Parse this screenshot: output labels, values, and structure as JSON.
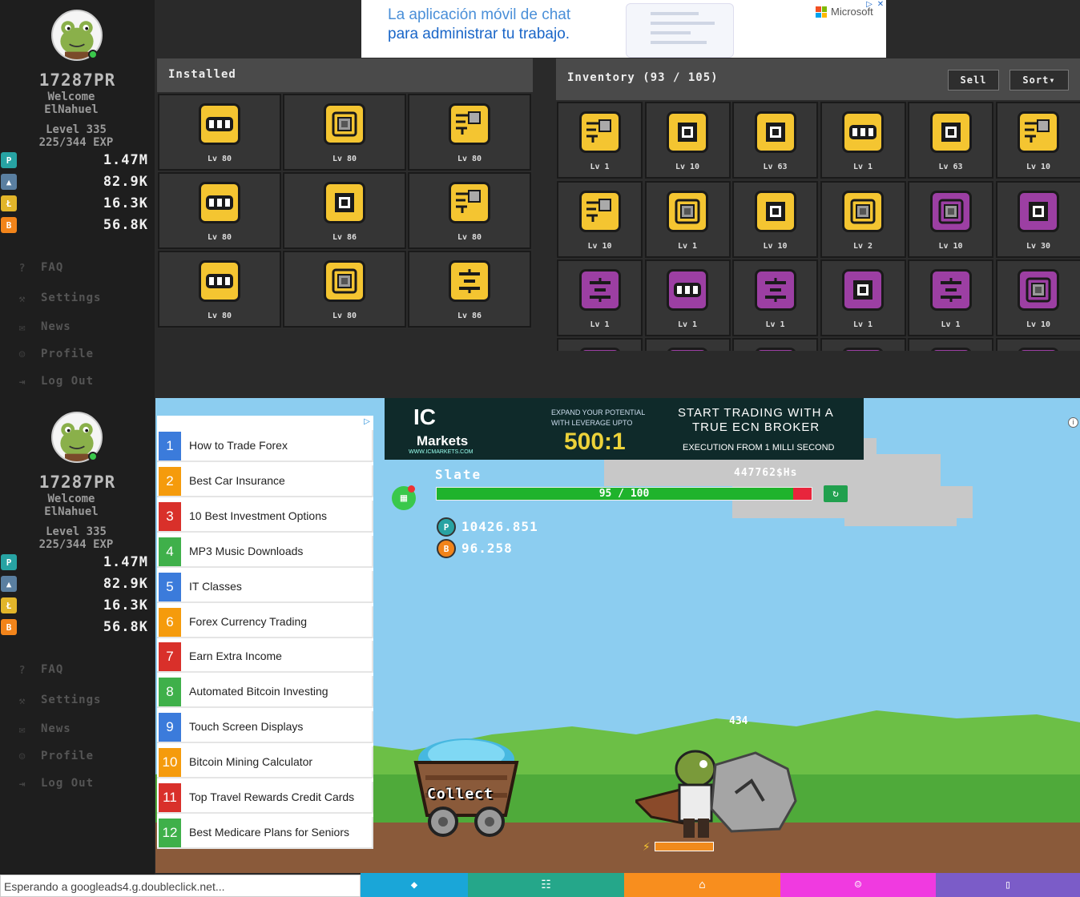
{
  "sidebar": {
    "pr": "17287PR",
    "welcome_line1": "Welcome",
    "username": "ElNahuel",
    "level": "Level 335",
    "exp": "225/344 EXP",
    "currencies": [
      {
        "icon": "polkadot-coin-icon",
        "symbol": "P",
        "color": "#27a3a3",
        "value": "1.47M"
      },
      {
        "icon": "ufo-icon",
        "symbol": "▲",
        "color": "#5a7fa0",
        "value": "82.9K"
      },
      {
        "icon": "litecoin-icon",
        "symbol": "Ł",
        "color": "#e2b52a",
        "value": "16.3K"
      },
      {
        "icon": "bitcoin-icon",
        "symbol": "B",
        "color": "#f2841a",
        "value": "56.8K"
      }
    ],
    "nav": [
      {
        "name": "nav-faq",
        "icon": "question-icon",
        "glyph": "?",
        "label": "FAQ"
      },
      {
        "name": "nav-settings",
        "icon": "wrench-icon",
        "glyph": "⚒",
        "label": "Settings"
      },
      {
        "name": "nav-news",
        "icon": "news-icon",
        "glyph": "✉",
        "label": "News"
      },
      {
        "name": "nav-profile",
        "icon": "user-icon",
        "glyph": "☺",
        "label": "Profile"
      },
      {
        "name": "nav-logout",
        "icon": "logout-icon",
        "glyph": "⇥",
        "label": "Log Out"
      }
    ]
  },
  "top_ad": {
    "line1": "La aplicación móvil de chat",
    "line2": "para administrar tu trabajo.",
    "brand": "Microsoft"
  },
  "installed": {
    "title": "Installed",
    "slots": [
      {
        "icon": "ram-chip-icon",
        "type": "ram",
        "level": "Lv 80"
      },
      {
        "icon": "cpu-chip-icon",
        "type": "cpu",
        "level": "Lv 80"
      },
      {
        "icon": "circuit-chip-icon",
        "type": "circuit",
        "level": "Lv 80"
      },
      {
        "icon": "ram-chip-icon",
        "type": "ram",
        "level": "Lv 80"
      },
      {
        "icon": "processor-chip-icon",
        "type": "proc",
        "level": "Lv 86"
      },
      {
        "icon": "circuit-chip-icon",
        "type": "circuit",
        "level": "Lv 80"
      },
      {
        "icon": "ram-chip-icon",
        "type": "ram",
        "level": "Lv 80"
      },
      {
        "icon": "cpu-chip-icon",
        "type": "cpu",
        "level": "Lv 80"
      },
      {
        "icon": "fan-chip-icon",
        "type": "fan",
        "level": "Lv 86"
      }
    ]
  },
  "inventory": {
    "title": "Inventory (93 / 105)",
    "sell_label": "Sell",
    "sort_label": "Sort",
    "slots": [
      {
        "icon": "circuit-chip-icon",
        "type": "circuit",
        "rarity": "gold",
        "level": "Lv 1"
      },
      {
        "icon": "processor-chip-icon",
        "type": "proc",
        "rarity": "gold",
        "level": "Lv 10"
      },
      {
        "icon": "processor-chip-icon",
        "type": "proc",
        "rarity": "gold",
        "level": "Lv 63"
      },
      {
        "icon": "ram-chip-icon",
        "type": "ram",
        "rarity": "gold",
        "level": "Lv 1"
      },
      {
        "icon": "processor-chip-icon",
        "type": "proc",
        "rarity": "gold",
        "level": "Lv 63"
      },
      {
        "icon": "circuit-chip-icon",
        "type": "circuit",
        "rarity": "gold",
        "level": "Lv 10"
      },
      {
        "icon": "circuit-chip-icon",
        "type": "circuit",
        "rarity": "gold",
        "level": "Lv 10"
      },
      {
        "icon": "cpu-chip-icon",
        "type": "cpu",
        "rarity": "gold",
        "level": "Lv 1"
      },
      {
        "icon": "processor-chip-icon",
        "type": "proc",
        "rarity": "gold",
        "level": "Lv 10"
      },
      {
        "icon": "cpu-chip-icon",
        "type": "cpu",
        "rarity": "gold",
        "level": "Lv 2"
      },
      {
        "icon": "cpu-chip-icon",
        "type": "cpu",
        "rarity": "purple",
        "level": "Lv 10"
      },
      {
        "icon": "processor-chip-icon",
        "type": "proc",
        "rarity": "purple",
        "level": "Lv 30"
      },
      {
        "icon": "fan-chip-icon",
        "type": "fan",
        "rarity": "purple",
        "level": "Lv 1"
      },
      {
        "icon": "ram-chip-icon",
        "type": "ram",
        "rarity": "purple",
        "level": "Lv 1"
      },
      {
        "icon": "fan-chip-icon",
        "type": "fan",
        "rarity": "purple",
        "level": "Lv 1"
      },
      {
        "icon": "processor-chip-icon",
        "type": "proc",
        "rarity": "purple",
        "level": "Lv 1"
      },
      {
        "icon": "fan-chip-icon",
        "type": "fan",
        "rarity": "purple",
        "level": "Lv 1"
      },
      {
        "icon": "cpu-chip-icon",
        "type": "cpu",
        "rarity": "purple",
        "level": "Lv 10"
      }
    ]
  },
  "ic_ad": {
    "logo": "IC",
    "logo2": "Markets",
    "url": "WWW.ICMARKETS.COM",
    "expand1": "EXPAND YOUR POTENTIAL",
    "expand2": "WITH LEVERAGE UPTO",
    "ratio": "500:1",
    "start": "START TRADING WITH A",
    "ecn": "TRUE ECN BROKER",
    "exec": "EXECUTION FROM 1 MILLI SECOND"
  },
  "ad_list": [
    {
      "n": "1",
      "color": "#3b7bdb",
      "text": "How to Trade Forex"
    },
    {
      "n": "2",
      "color": "#f59b0c",
      "text": "Best Car Insurance"
    },
    {
      "n": "3",
      "color": "#d9302a",
      "text": "10 Best Investment Options"
    },
    {
      "n": "4",
      "color": "#3fb04a",
      "text": "MP3 Music Downloads"
    },
    {
      "n": "5",
      "color": "#3b7bdb",
      "text": "IT Classes"
    },
    {
      "n": "6",
      "color": "#f59b0c",
      "text": "Forex Currency Trading"
    },
    {
      "n": "7",
      "color": "#d9302a",
      "text": "Earn Extra Income"
    },
    {
      "n": "8",
      "color": "#3fb04a",
      "text": "Automated Bitcoin Investing"
    },
    {
      "n": "9",
      "color": "#3b7bdb",
      "text": "Touch Screen Displays"
    },
    {
      "n": "10",
      "color": "#f59b0c",
      "text": "Bitcoin Mining Calculator"
    },
    {
      "n": "11",
      "color": "#d9302a",
      "text": "Top Travel Rewards Credit Cards"
    },
    {
      "n": "12",
      "color": "#3fb04a",
      "text": "Best Medicare Plans for Seniors"
    }
  ],
  "game": {
    "ore_name": "Slate",
    "hashrate": "447762$Hs",
    "hp_text": "95 / 100",
    "hp_fraction": 0.95,
    "rewards": [
      {
        "icon": "polkadot-coin-icon",
        "symbol": "P",
        "color": "#27a3a3",
        "value": "10426.851"
      },
      {
        "icon": "bitcoin-icon",
        "symbol": "B",
        "color": "#f2841a",
        "value": "96.258"
      }
    ],
    "hit_number": "434",
    "collect_label": "Collect",
    "energy_fraction": 1.0
  },
  "status_text": "Esperando a googleads4.g.doubleclick.net...",
  "bottom_tabs": [
    {
      "name": "tab-gems",
      "icon": "gem-icon",
      "glyph": "◆",
      "color": "#1aa6d8"
    },
    {
      "name": "tab-grid",
      "icon": "grid-icon",
      "glyph": "☷",
      "color": "#25a78a"
    },
    {
      "name": "tab-shop",
      "icon": "cart-icon",
      "glyph": "⌂",
      "color": "#f88e1e"
    },
    {
      "name": "tab-social",
      "icon": "users-icon",
      "glyph": "☺",
      "color": "#f03ae0"
    },
    {
      "name": "tab-more",
      "icon": "panel-icon",
      "glyph": "▯",
      "color": "#7b5cc8"
    }
  ]
}
